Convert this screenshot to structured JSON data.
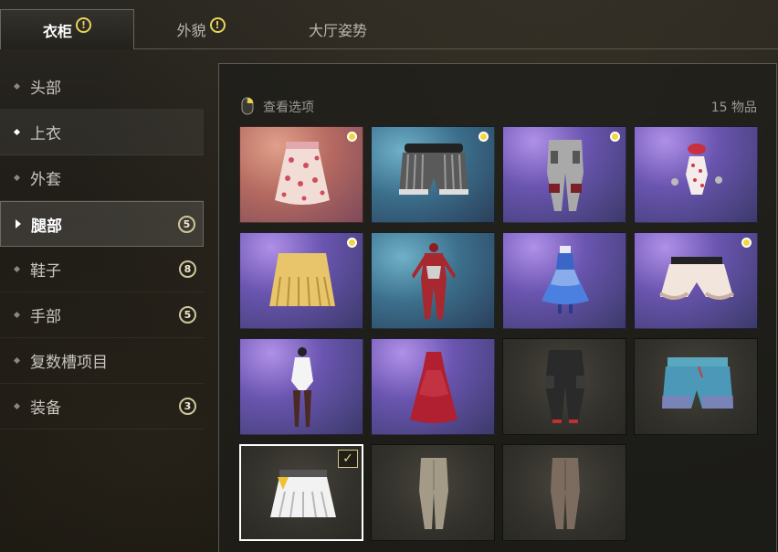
{
  "tabs": [
    {
      "label": "衣柜",
      "alert": "!"
    },
    {
      "label": "外貌",
      "alert": "!"
    },
    {
      "label": "大厅姿势"
    }
  ],
  "sidebar": {
    "items": [
      {
        "label": "头部"
      },
      {
        "label": "上衣"
      },
      {
        "label": "外套"
      },
      {
        "label": "腿部",
        "badge": "5"
      },
      {
        "label": "鞋子",
        "badge": "8"
      },
      {
        "label": "手部",
        "badge": "5"
      },
      {
        "label": "复数槽项目"
      },
      {
        "label": "装备",
        "badge": "3"
      }
    ]
  },
  "panel": {
    "view_options": "查看选项",
    "item_count": "15 物品"
  },
  "items": [
    {
      "name": "floral-skirt",
      "bg": "pink",
      "new": true
    },
    {
      "name": "striped-shorts",
      "bg": "teal",
      "new": true
    },
    {
      "name": "armored-pants",
      "bg": "purple",
      "new": true
    },
    {
      "name": "polka-swimsuit",
      "bg": "purple",
      "new": false
    },
    {
      "name": "yellow-pleated-skirt",
      "bg": "purple",
      "new": true
    },
    {
      "name": "red-bodysuit",
      "bg": "teal",
      "new": false
    },
    {
      "name": "blue-dress",
      "bg": "purple",
      "new": false
    },
    {
      "name": "bloomers",
      "bg": "purple",
      "new": true
    },
    {
      "name": "white-swimsuit",
      "bg": "purple",
      "new": false
    },
    {
      "name": "red-dress",
      "bg": "purple",
      "new": false
    },
    {
      "name": "black-cargo-pants",
      "bg": "dark",
      "new": false
    },
    {
      "name": "blue-shorts",
      "bg": "dark",
      "new": false
    },
    {
      "name": "white-skirt",
      "bg": "dark",
      "new": false,
      "equipped": true
    },
    {
      "name": "khaki-pants",
      "bg": "dark",
      "new": false
    },
    {
      "name": "brown-pants",
      "bg": "dark",
      "new": false
    }
  ],
  "colors": {
    "accent": "#f2d63b",
    "badge": "#cfc79a"
  }
}
